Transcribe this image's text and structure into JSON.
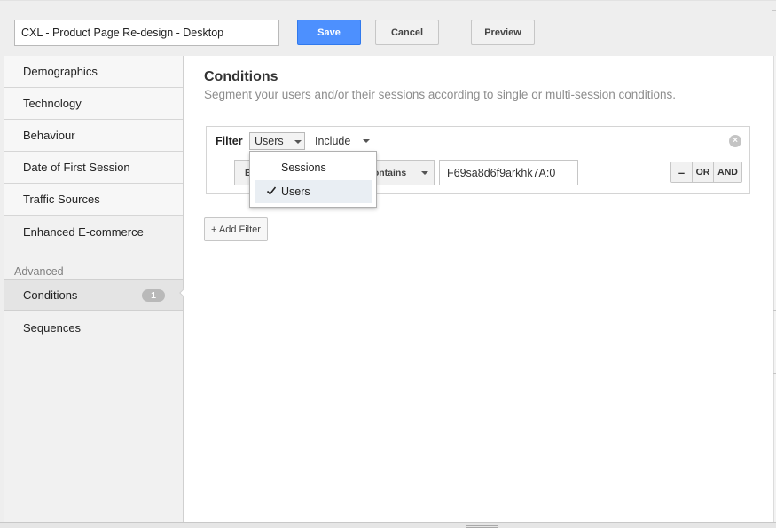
{
  "toolbar": {
    "segment_name": "CXL - Product Page Re-design - Desktop",
    "save_label": "Save",
    "cancel_label": "Cancel",
    "preview_label": "Preview"
  },
  "sidebar": {
    "items": [
      {
        "label": "Demographics"
      },
      {
        "label": "Technology"
      },
      {
        "label": "Behaviour"
      },
      {
        "label": "Date of First Session"
      },
      {
        "label": "Traffic Sources"
      },
      {
        "label": "Enhanced E-commerce"
      }
    ],
    "advanced_heading": "Advanced",
    "advanced_items": [
      {
        "label": "Conditions",
        "count": "1",
        "active": true
      },
      {
        "label": "Sequences"
      }
    ]
  },
  "main": {
    "title": "Conditions",
    "description": "Segment your users and/or their sessions according to single or multi-session conditions.",
    "filter": {
      "label": "Filter",
      "scope_value": "Users",
      "include_value": "Include",
      "dimension_partial": "E",
      "operator": "contains",
      "value": "F69sa8d6f9arkhk7A:0",
      "logic_minus": "–",
      "logic_or": "OR",
      "logic_and": "AND",
      "remove_icon": "close-circle-icon"
    },
    "add_filter_label": "+ Add Filter"
  },
  "dropdown": {
    "options": [
      {
        "label": "Sessions"
      },
      {
        "label": "Users",
        "selected": true
      }
    ]
  },
  "colors": {
    "primary": "#4d90fe",
    "sidebar_bg": "#f1f1f1",
    "active_bg": "#e4e4e4",
    "muted_text": "#8d8d8d"
  }
}
